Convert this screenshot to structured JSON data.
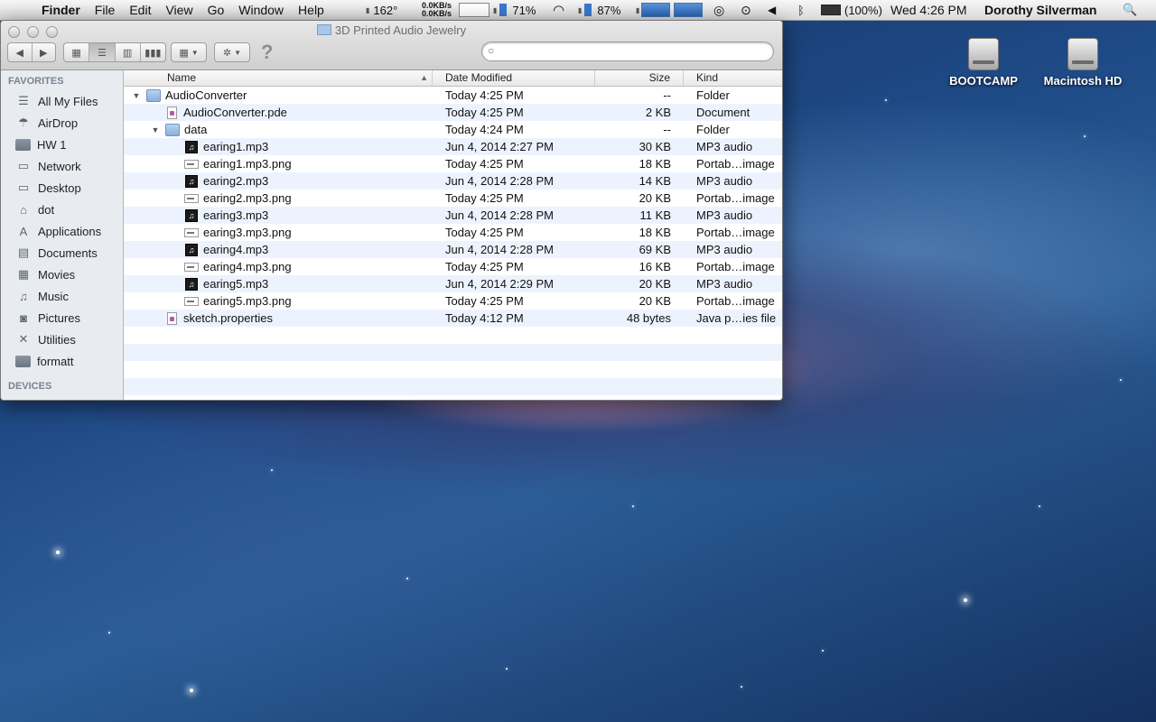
{
  "menubar": {
    "apple": "",
    "app_name": "Finder",
    "menus": [
      "File",
      "Edit",
      "View",
      "Go",
      "Window",
      "Help"
    ],
    "temp": "162°",
    "net_up": "0.0KB/s",
    "net_down": "0.0KB/s",
    "mem_percent": "71%",
    "battery_small": "87%",
    "battery": "(100%)",
    "clock": "Wed 4:26 PM",
    "user": "Dorothy Silverman",
    "search_icon": "🔍"
  },
  "window": {
    "title": "3D Printed Audio Jewelry",
    "search_placeholder": ""
  },
  "sidebar": {
    "favorites_header": "FAVORITES",
    "items": [
      {
        "label": "All My Files",
        "icon": "☰"
      },
      {
        "label": "AirDrop",
        "icon": "☂"
      },
      {
        "label": "HW 1",
        "icon": "folder"
      },
      {
        "label": "Network",
        "icon": "▭"
      },
      {
        "label": "Desktop",
        "icon": "▭"
      },
      {
        "label": "dot",
        "icon": "⌂"
      },
      {
        "label": "Applications",
        "icon": "A"
      },
      {
        "label": "Documents",
        "icon": "▤"
      },
      {
        "label": "Movies",
        "icon": "▦"
      },
      {
        "label": "Music",
        "icon": "♫"
      },
      {
        "label": "Pictures",
        "icon": "◙"
      },
      {
        "label": "Utilities",
        "icon": "✕"
      },
      {
        "label": "formatt",
        "icon": "folder"
      }
    ],
    "devices_header": "DEVICES"
  },
  "columns": {
    "name": "Name",
    "date": "Date Modified",
    "size": "Size",
    "kind": "Kind"
  },
  "files": [
    {
      "name": "AudioConverter",
      "date": "Today 4:25 PM",
      "size": "--",
      "kind": "Folder",
      "icon": "folder",
      "level": 0,
      "disclosure": "▼"
    },
    {
      "name": "AudioConverter.pde",
      "date": "Today 4:25 PM",
      "size": "2 KB",
      "kind": "Document",
      "icon": "doc",
      "level": 1,
      "disclosure": ""
    },
    {
      "name": "data",
      "date": "Today 4:24 PM",
      "size": "--",
      "kind": "Folder",
      "icon": "folder",
      "level": 1,
      "disclosure": "▼"
    },
    {
      "name": "earing1.mp3",
      "date": "Jun 4, 2014 2:27 PM",
      "size": "30 KB",
      "kind": "MP3 audio",
      "icon": "mp3",
      "level": 2,
      "disclosure": ""
    },
    {
      "name": "earing1.mp3.png",
      "date": "Today 4:25 PM",
      "size": "18 KB",
      "kind": "Portab…image",
      "icon": "png",
      "level": 2,
      "disclosure": ""
    },
    {
      "name": "earing2.mp3",
      "date": "Jun 4, 2014 2:28 PM",
      "size": "14 KB",
      "kind": "MP3 audio",
      "icon": "mp3",
      "level": 2,
      "disclosure": ""
    },
    {
      "name": "earing2.mp3.png",
      "date": "Today 4:25 PM",
      "size": "20 KB",
      "kind": "Portab…image",
      "icon": "png",
      "level": 2,
      "disclosure": ""
    },
    {
      "name": "earing3.mp3",
      "date": "Jun 4, 2014 2:28 PM",
      "size": "11 KB",
      "kind": "MP3 audio",
      "icon": "mp3",
      "level": 2,
      "disclosure": ""
    },
    {
      "name": "earing3.mp3.png",
      "date": "Today 4:25 PM",
      "size": "18 KB",
      "kind": "Portab…image",
      "icon": "png",
      "level": 2,
      "disclosure": ""
    },
    {
      "name": "earing4.mp3",
      "date": "Jun 4, 2014 2:28 PM",
      "size": "69 KB",
      "kind": "MP3 audio",
      "icon": "mp3",
      "level": 2,
      "disclosure": ""
    },
    {
      "name": "earing4.mp3.png",
      "date": "Today 4:25 PM",
      "size": "16 KB",
      "kind": "Portab…image",
      "icon": "png",
      "level": 2,
      "disclosure": ""
    },
    {
      "name": "earing5.mp3",
      "date": "Jun 4, 2014 2:29 PM",
      "size": "20 KB",
      "kind": "MP3 audio",
      "icon": "mp3",
      "level": 2,
      "disclosure": ""
    },
    {
      "name": "earing5.mp3.png",
      "date": "Today 4:25 PM",
      "size": "20 KB",
      "kind": "Portab…image",
      "icon": "png",
      "level": 2,
      "disclosure": ""
    },
    {
      "name": "sketch.properties",
      "date": "Today 4:12 PM",
      "size": "48 bytes",
      "kind": "Java p…ies file",
      "icon": "doc",
      "level": 1,
      "disclosure": ""
    }
  ],
  "desktop_icons": [
    {
      "label": "BOOTCAMP"
    },
    {
      "label": "Macintosh HD"
    }
  ]
}
